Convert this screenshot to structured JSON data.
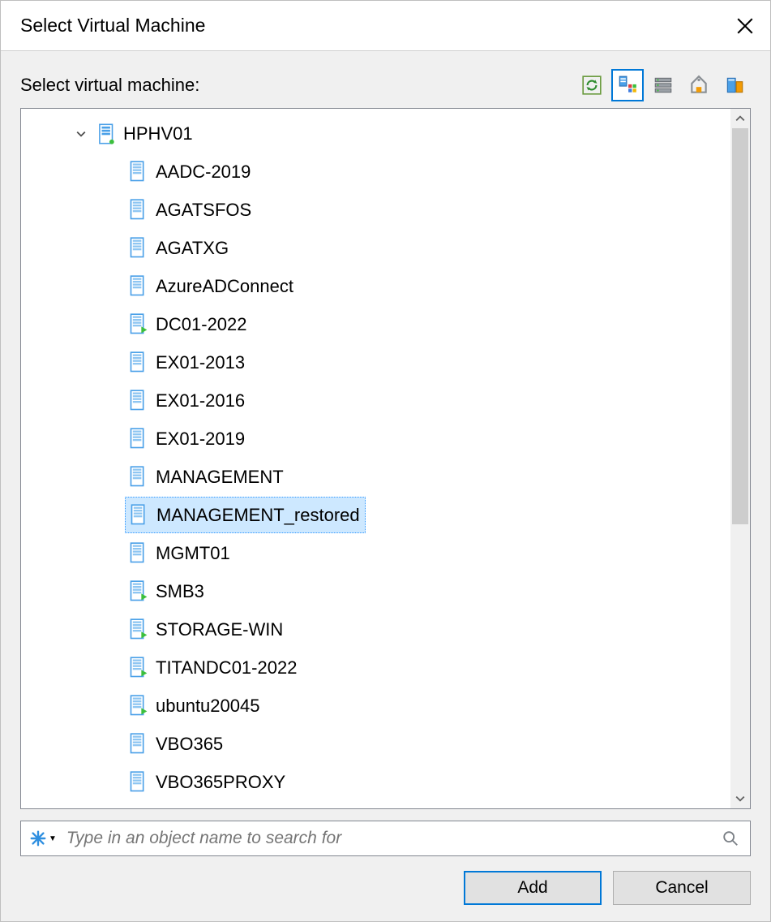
{
  "dialog": {
    "title": "Select Virtual Machine",
    "close_label": "Close"
  },
  "prompt": "Select virtual machine:",
  "toolbar": {
    "refresh": "Refresh",
    "view_hosts": "Hosts and Clusters",
    "view_vms": "VMs and Templates",
    "view_tags": "Tags",
    "view_storage": "Datastores"
  },
  "tree": {
    "host": {
      "name": "HPHV01",
      "expanded": true
    },
    "vms": [
      {
        "name": "AADC-2019",
        "running": false,
        "selected": false
      },
      {
        "name": "AGATSFOS",
        "running": false,
        "selected": false
      },
      {
        "name": "AGATXG",
        "running": false,
        "selected": false
      },
      {
        "name": "AzureADConnect",
        "running": false,
        "selected": false
      },
      {
        "name": "DC01-2022",
        "running": true,
        "selected": false
      },
      {
        "name": "EX01-2013",
        "running": false,
        "selected": false
      },
      {
        "name": "EX01-2016",
        "running": false,
        "selected": false
      },
      {
        "name": "EX01-2019",
        "running": false,
        "selected": false
      },
      {
        "name": "MANAGEMENT",
        "running": false,
        "selected": false
      },
      {
        "name": "MANAGEMENT_restored",
        "running": false,
        "selected": true
      },
      {
        "name": "MGMT01",
        "running": false,
        "selected": false
      },
      {
        "name": "SMB3",
        "running": true,
        "selected": false
      },
      {
        "name": "STORAGE-WIN",
        "running": true,
        "selected": false
      },
      {
        "name": "TITANDC01-2022",
        "running": true,
        "selected": false
      },
      {
        "name": "ubuntu20045",
        "running": true,
        "selected": false
      },
      {
        "name": "VBO365",
        "running": false,
        "selected": false
      },
      {
        "name": "VBO365PROXY",
        "running": false,
        "selected": false
      }
    ]
  },
  "search": {
    "placeholder": "Type in an object name to search for",
    "value": ""
  },
  "buttons": {
    "add": "Add",
    "cancel": "Cancel"
  }
}
